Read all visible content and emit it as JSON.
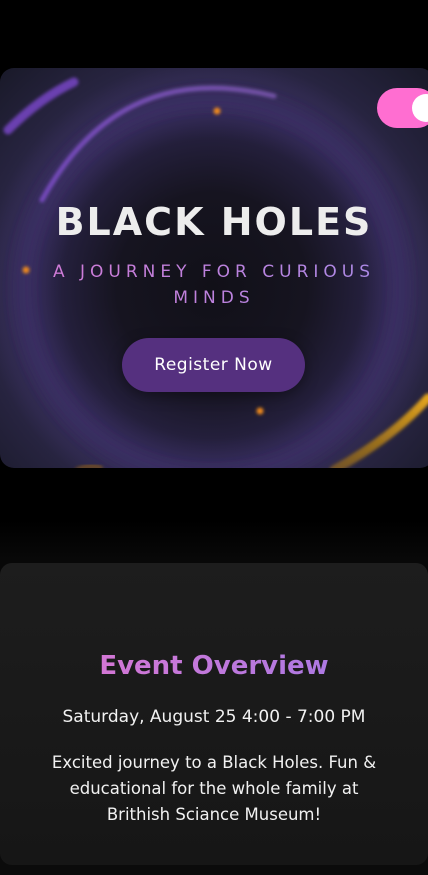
{
  "hero": {
    "title": "BLACK HOLES",
    "subtitle": "A JOURNEY FOR CURIOUS MINDS",
    "register_label": "Register Now"
  },
  "theme_toggle": {
    "state": "on",
    "color": "#ff6ed1"
  },
  "overview": {
    "title": "Event Overview",
    "date_time": "Saturday, August 25 4:00 - 7:00 PM",
    "description": "Excited journey to a Black Holes. Fun & educational for the whole family at Brithish Sciance Museum!"
  },
  "colors": {
    "background": "#000000",
    "accent_purple": "#55307f",
    "accent_pink": "#ff6ed1",
    "star_orange": "#f08a1a",
    "ring_gold": "#d99a1c"
  }
}
